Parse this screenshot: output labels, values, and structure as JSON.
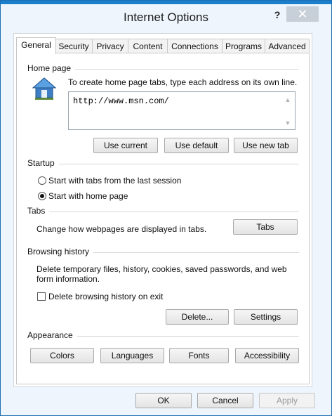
{
  "window": {
    "title": "Internet Options",
    "help": "?",
    "close": "✕"
  },
  "tabs": [
    {
      "label": "General",
      "active": true
    },
    {
      "label": "Security"
    },
    {
      "label": "Privacy"
    },
    {
      "label": "Content"
    },
    {
      "label": "Connections"
    },
    {
      "label": "Programs"
    },
    {
      "label": "Advanced"
    }
  ],
  "home_page": {
    "heading": "Home page",
    "description": "To create home page tabs, type each address on its own line.",
    "address_value": "http://www.msn.com/",
    "buttons": {
      "use_current": "Use current",
      "use_default": "Use default",
      "use_new_tab": "Use new tab"
    }
  },
  "startup": {
    "heading": "Startup",
    "option_last_session": "Start with tabs from the last session",
    "option_home_page": "Start with home page",
    "selected": "home_page"
  },
  "tabs_section": {
    "heading": "Tabs",
    "description": "Change how webpages are displayed in tabs.",
    "button": "Tabs"
  },
  "browsing_history": {
    "heading": "Browsing history",
    "description": "Delete temporary files, history, cookies, saved passwords, and web form information.",
    "checkbox_label": "Delete browsing history on exit",
    "checkbox_checked": false,
    "delete_button": "Delete...",
    "settings_button": "Settings"
  },
  "appearance": {
    "heading": "Appearance",
    "buttons": {
      "colors": "Colors",
      "languages": "Languages",
      "fonts": "Fonts",
      "accessibility": "Accessibility"
    }
  },
  "footer": {
    "ok": "OK",
    "cancel": "Cancel",
    "apply": "Apply"
  },
  "colors": {
    "accent": "#1a7fcc",
    "window_bg": "#eef5fc",
    "close_bg": "#c7cfd8"
  }
}
